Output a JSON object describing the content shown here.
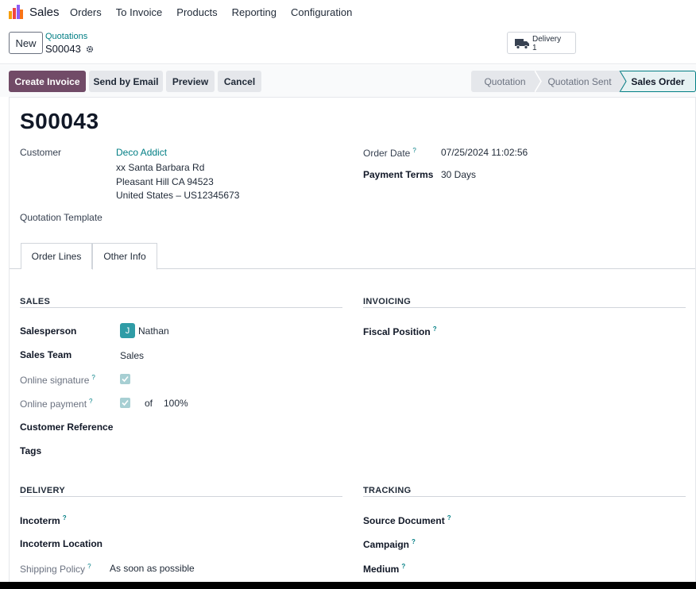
{
  "app": {
    "name": "Sales",
    "menu": [
      "Orders",
      "To Invoice",
      "Products",
      "Reporting",
      "Configuration"
    ]
  },
  "control": {
    "new_label": "New",
    "breadcrumb_parent": "Quotations",
    "breadcrumb_current": "S00043",
    "smart_button": {
      "label": "Delivery",
      "count": "1",
      "icon": "truck-icon"
    }
  },
  "actions": {
    "create_invoice": "Create Invoice",
    "send_email": "Send by Email",
    "preview": "Preview",
    "cancel": "Cancel"
  },
  "stages": {
    "items": [
      "Quotation",
      "Quotation Sent",
      "Sales Order"
    ],
    "active": "Sales Order"
  },
  "form": {
    "title": "S00043",
    "customer_label": "Customer",
    "customer_name": "Deco Addict",
    "address_line1": "xx Santa Barbara Rd",
    "address_line2": "Pleasant Hill CA 94523",
    "address_line3": "United States – US12345673",
    "quotation_template_label": "Quotation Template",
    "order_date_label": "Order Date",
    "order_date_value": "07/25/2024 11:02:56",
    "payment_terms_label": "Payment Terms",
    "payment_terms_value": "30 Days",
    "help_mark": "?"
  },
  "tabs": {
    "order_lines": "Order Lines",
    "other_info": "Other Info",
    "active": "Other Info"
  },
  "sales": {
    "heading": "SALES",
    "salesperson_label": "Salesperson",
    "salesperson_initial": "J",
    "salesperson_value": "Nathan",
    "sales_team_label": "Sales Team",
    "sales_team_value": "Sales",
    "online_signature_label": "Online signature",
    "online_signature_checked": true,
    "online_payment_label": "Online payment",
    "online_payment_checked": true,
    "online_payment_of": "of",
    "online_payment_percent": "100%",
    "customer_reference_label": "Customer Reference",
    "tags_label": "Tags"
  },
  "invoicing": {
    "heading": "INVOICING",
    "fiscal_position_label": "Fiscal Position"
  },
  "delivery": {
    "heading": "DELIVERY",
    "incoterm_label": "Incoterm",
    "incoterm_location_label": "Incoterm Location",
    "shipping_policy_label": "Shipping Policy",
    "shipping_policy_value": "As soon as possible"
  },
  "tracking": {
    "heading": "TRACKING",
    "source_document_label": "Source Document",
    "campaign_label": "Campaign",
    "medium_label": "Medium"
  },
  "colors": {
    "brand": "#714b67",
    "accent": "#017e84"
  }
}
